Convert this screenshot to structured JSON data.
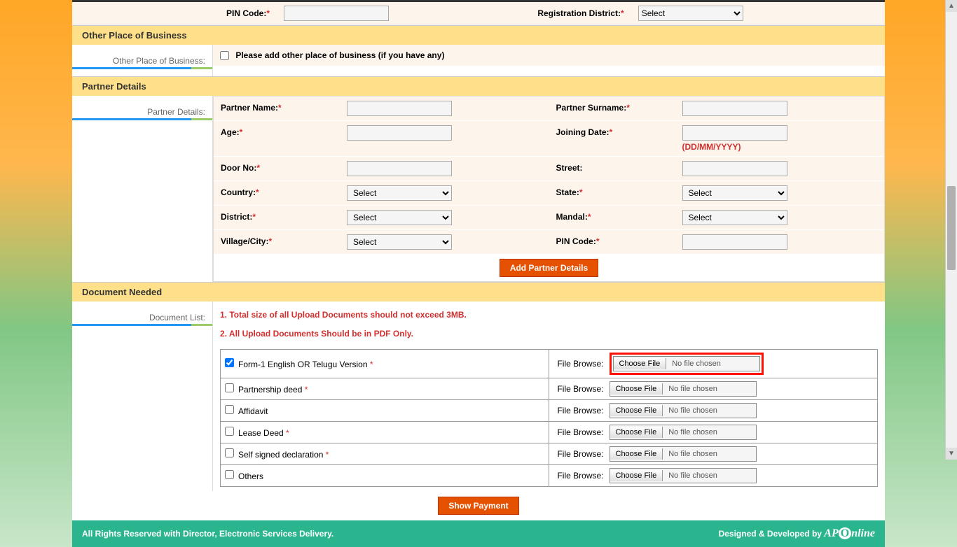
{
  "topFields": {
    "pinCode": {
      "label": "PIN Code:",
      "value": ""
    },
    "regDistrict": {
      "label": "Registration District:",
      "placeholder": "Select"
    }
  },
  "otherPlace": {
    "header": "Other Place of Business",
    "leftLabel": "Other Place of Business:",
    "checkboxLabel": "Please add other place of business (if you have any)"
  },
  "partner": {
    "header": "Partner Details",
    "leftLabel": "Partner Details:",
    "fields": {
      "name": "Partner Name:",
      "surname": "Partner Surname:",
      "age": "Age:",
      "joining": "Joining Date:",
      "dateHint": "(DD/MM/YYYY)",
      "door": "Door No:",
      "street": "Street:",
      "country": "Country:",
      "state": "State:",
      "district": "District:",
      "mandal": "Mandal:",
      "village": "Village/City:",
      "pin": "PIN Code:"
    },
    "selectPlaceholder": "Select",
    "addButton": "Add Partner Details"
  },
  "documents": {
    "header": "Document Needed",
    "leftLabel": "Document List:",
    "note1": "1. Total size of all Upload Documents should not exceed 3MB.",
    "note2": "2. All Upload Documents Should be in PDF Only.",
    "browseLabel": "File Browse:",
    "chooseFile": "Choose File",
    "noFile": "No file chosen",
    "items": [
      {
        "name": "Form-1 English OR Telugu Version",
        "required": true,
        "checked": true,
        "highlight": true
      },
      {
        "name": "Partnership deed",
        "required": true,
        "checked": false,
        "highlight": false
      },
      {
        "name": "Affidavit",
        "required": false,
        "checked": false,
        "highlight": false
      },
      {
        "name": "Lease Deed",
        "required": true,
        "checked": false,
        "highlight": false
      },
      {
        "name": "Self signed declaration",
        "required": true,
        "checked": false,
        "highlight": false
      },
      {
        "name": "Others",
        "required": false,
        "checked": false,
        "highlight": false
      }
    ]
  },
  "showPayment": "Show Payment",
  "footer": {
    "left": "All Rights Reserved with Director, Electronic Services Delivery.",
    "right": "Designed & Developed by"
  }
}
